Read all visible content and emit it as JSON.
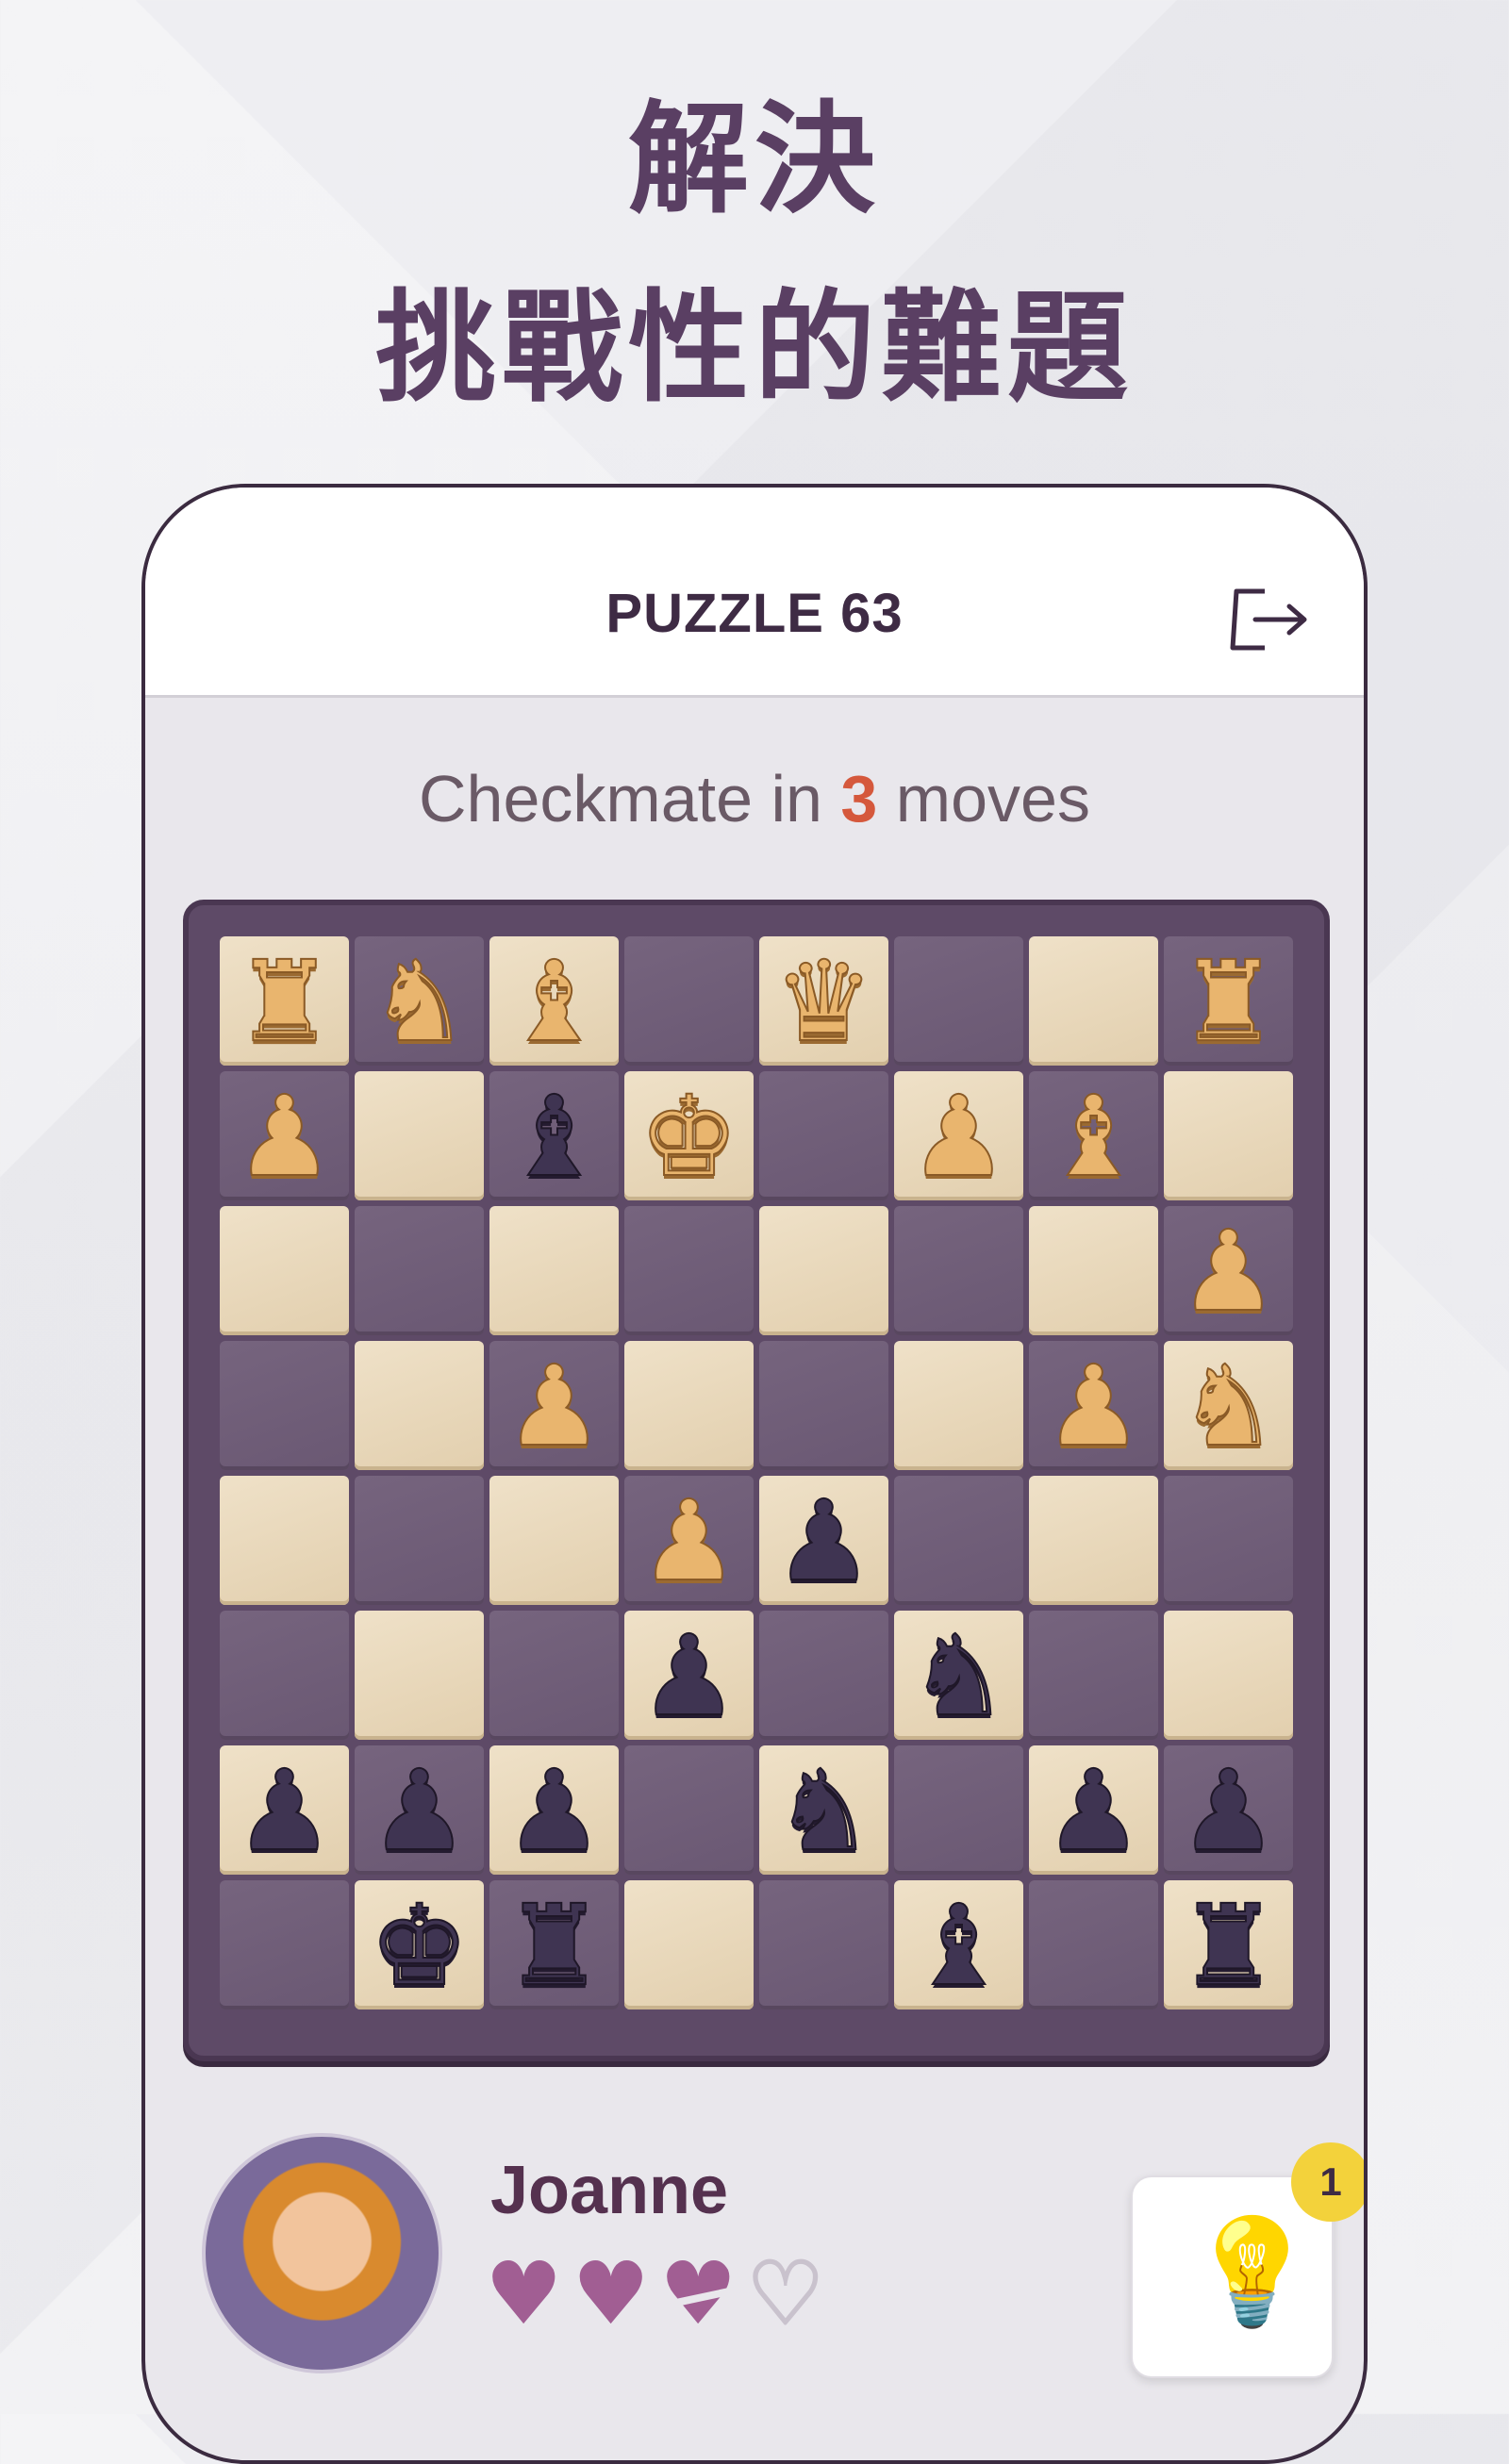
{
  "headline": {
    "line1": "解決",
    "line2": "挑戰性的難題"
  },
  "header": {
    "title": "PUZZLE 63",
    "exit_icon": "exit-icon"
  },
  "task": {
    "prefix": "Checkmate in ",
    "moves": "3",
    "suffix": " moves"
  },
  "board": {
    "rows": [
      [
        "wR",
        "wN",
        "wB",
        "",
        "wQ",
        "",
        "",
        "wR"
      ],
      [
        "wP",
        "",
        "bB",
        "wK",
        "",
        "wP",
        "wB",
        ""
      ],
      [
        "",
        "",
        "",
        "",
        "",
        "",
        "",
        "wP"
      ],
      [
        "",
        "",
        "wP",
        "",
        "",
        "",
        "wP",
        "wN"
      ],
      [
        "",
        "",
        "",
        "wP",
        "bP",
        "",
        "",
        ""
      ],
      [
        "",
        "",
        "",
        "bP",
        "",
        "bN",
        "",
        ""
      ],
      [
        "bP",
        "bP",
        "bP",
        "",
        "bN",
        "",
        "bP",
        "bP"
      ],
      [
        "",
        "bK",
        "bR",
        "",
        "",
        "bB",
        "",
        "bR"
      ]
    ]
  },
  "player": {
    "name": "Joanne",
    "hearts": [
      "full",
      "full",
      "broken",
      "empty"
    ]
  },
  "hint": {
    "badge": "1",
    "icon": "lightbulb-icon"
  },
  "colors": {
    "accent": "#d5583c",
    "primary": "#5a3f63",
    "heart": "#a15e93",
    "badge": "#f3d23b"
  }
}
